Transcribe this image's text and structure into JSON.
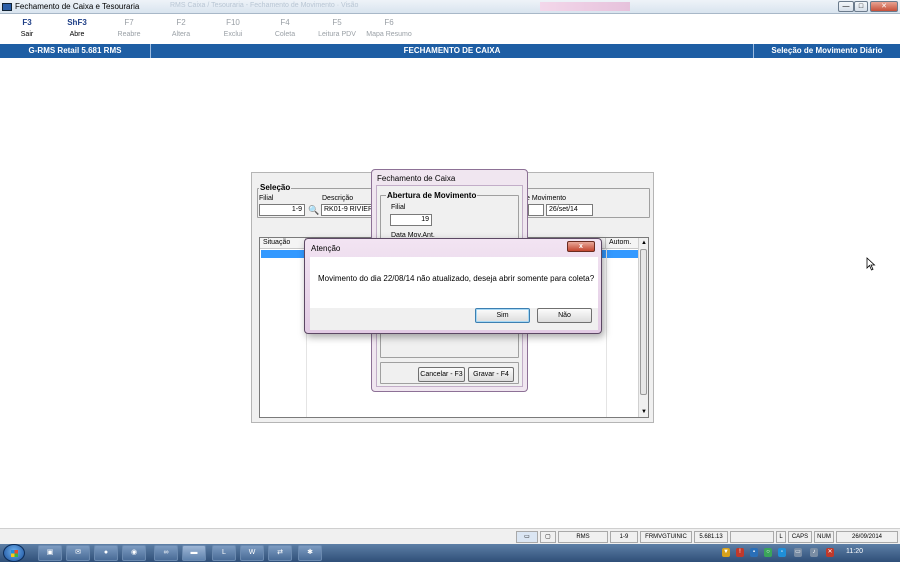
{
  "window": {
    "title": "Fechamento de Caixa e Tesouraria",
    "ghost_title": "RMS Caixa / Tesouraria - Fechamento de Movimento · Visão",
    "buttons": {
      "minimize": "—",
      "maximize": "□",
      "close": "✕"
    }
  },
  "toolbar": {
    "items": [
      {
        "key": "F3",
        "label": "Sair",
        "enabled": true
      },
      {
        "key": "ShF3",
        "label": "Abre",
        "enabled": true
      },
      {
        "key": "F7",
        "label": "Reabre",
        "enabled": false
      },
      {
        "key": "F2",
        "label": "Altera",
        "enabled": false
      },
      {
        "key": "F10",
        "label": "Exclui",
        "enabled": false
      },
      {
        "key": "F4",
        "label": "Coleta",
        "enabled": false
      },
      {
        "key": "F5",
        "label": "Leitura PDV",
        "enabled": false
      },
      {
        "key": "F6",
        "label": "Mapa Resumo",
        "enabled": false
      }
    ]
  },
  "header_bar": {
    "app": "G-RMS Retail 5.681 RMS",
    "screen": "FECHAMENTO DE CAIXA",
    "context": "Seleção de Movimento Diário",
    "color": "#1e5ea4"
  },
  "selection": {
    "group_label": "Seleção",
    "filial_label": "Filial",
    "filial_value": "1-9",
    "descricao_label": "Descrição",
    "descricao_value": "RK01-9 RIVIERA",
    "movimento_label": "e Movimento",
    "movimento_value": "26/set/14",
    "list_columns": {
      "situacao": "Situação",
      "autom": "Autom."
    }
  },
  "fechamento_dialog": {
    "title": "Fechamento de Caixa",
    "group_label": "Abertura de Movimento",
    "filial_label": "Filial",
    "filial_value": "19",
    "data_label": "Data Mov.Ant.",
    "cancel_button": "Cancelar - F3",
    "save_button": "Gravar - F4"
  },
  "alert_dialog": {
    "title": "Atenção",
    "message": "Movimento do dia 22/08/14 não atualizado, deseja abrir somente para coleta?",
    "yes": "Sim",
    "no": "Não",
    "close_glyph": "x"
  },
  "statusbar": {
    "db": "RMS",
    "filial": "1-9",
    "program": "FRMVGTUINIC",
    "version": "5.681.13",
    "l": "L",
    "caps": "CAPS",
    "num": "NUM",
    "date": "26/09/2014"
  },
  "taskbar": {
    "time": "11:20"
  }
}
